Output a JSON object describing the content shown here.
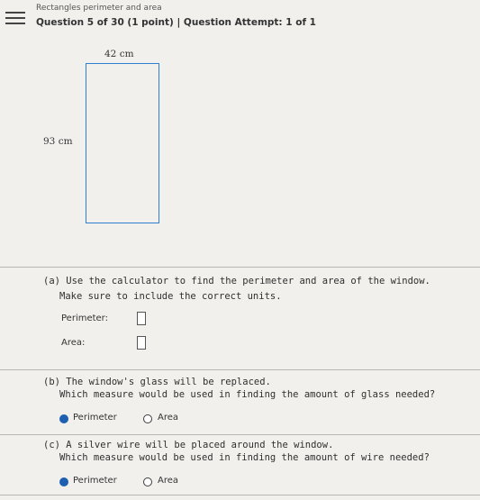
{
  "header": {
    "topic": "Rectangles perimeter and area",
    "question_line": "Question 5 of 30 (1 point)  |  Question Attempt: 1 of 1"
  },
  "figure": {
    "width_label": "42 cm",
    "height_label": "93 cm"
  },
  "part_a": {
    "prompt_line1": "(a) Use the calculator to find the perimeter and area of the window.",
    "prompt_line2": "Make sure to include the correct units.",
    "perimeter_label": "Perimeter:",
    "area_label": "Area:",
    "perimeter_value": "",
    "area_value": ""
  },
  "part_b": {
    "prompt_line1": "(b) The window's glass will be replaced.",
    "prompt_line2": "Which measure would be used in finding the amount of glass needed?",
    "options": [
      "Perimeter",
      "Area"
    ],
    "selected": "Perimeter"
  },
  "part_c": {
    "prompt_line1": "(c) A silver wire will be placed around the window.",
    "prompt_line2": "Which measure would be used in finding the amount of wire needed?",
    "options": [
      "Perimeter",
      "Area"
    ],
    "selected": "Perimeter"
  },
  "colors": {
    "rectangle_outline": "#2f7fd0",
    "selected_radio": "#1f5fb0"
  }
}
